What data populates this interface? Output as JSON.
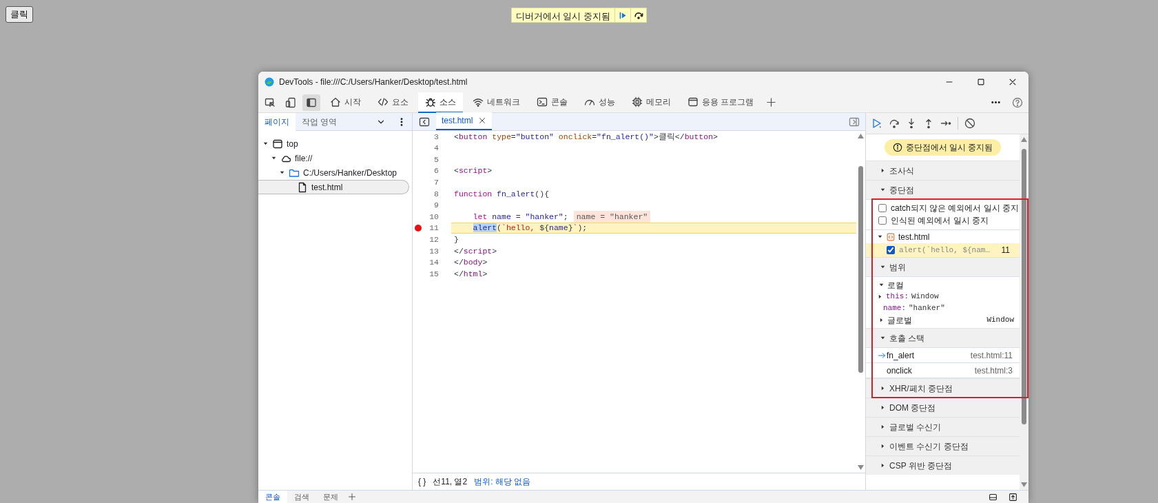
{
  "page_button": "클릭",
  "paused_banner": {
    "text": "디버거에서 일시 중지됨"
  },
  "window": {
    "title": "DevTools - file:///C:/Users/Hanker/Desktop/test.html"
  },
  "toolbar_tabs": [
    {
      "label": "시작",
      "kind": "home",
      "selected": false
    },
    {
      "label": "요소",
      "kind": "code",
      "selected": false
    },
    {
      "label": "소스",
      "kind": "bug",
      "selected": true
    },
    {
      "label": "네트워크",
      "kind": "wifi",
      "selected": false
    },
    {
      "label": "콘솔",
      "kind": "terminal",
      "selected": false
    },
    {
      "label": "성능",
      "kind": "gauge",
      "selected": false
    },
    {
      "label": "메모리",
      "kind": "chip",
      "selected": false
    },
    {
      "label": "응용 프로그램",
      "kind": "window",
      "selected": false
    }
  ],
  "navigator": {
    "tabs": [
      {
        "label": "페이지",
        "selected": true
      },
      {
        "label": "작업 영역",
        "selected": false
      }
    ],
    "tree": [
      {
        "label": "top",
        "kind": "frame",
        "expanded": true,
        "selected": false,
        "children": [
          {
            "label": "file://",
            "kind": "cloud",
            "expanded": true,
            "selected": false,
            "children": [
              {
                "label": "C:/Users/Hanker/Desktop",
                "kind": "folder",
                "expanded": true,
                "selected": false,
                "children": [
                  {
                    "label": "test.html",
                    "kind": "file",
                    "selected": true
                  }
                ]
              }
            ]
          }
        ]
      }
    ]
  },
  "editor": {
    "tabs": [
      {
        "label": "test.html",
        "selected": true
      }
    ],
    "lines": [
      {
        "number": "3",
        "breakpoint": false,
        "paused": false,
        "tokens": [
          {
            "kind": "punct",
            "text": "<"
          },
          {
            "kind": "tag",
            "text": "button"
          },
          {
            "kind": "attr",
            "text": " type"
          },
          {
            "kind": "punct",
            "text": "="
          },
          {
            "kind": "value",
            "text": "\"button\""
          },
          {
            "kind": "attr",
            "text": " onclick"
          },
          {
            "kind": "punct",
            "text": "="
          },
          {
            "kind": "value",
            "text": "\"fn_alert()\""
          },
          {
            "kind": "punct",
            "text": ">"
          },
          {
            "kind": "plain",
            "text": "클릭"
          },
          {
            "kind": "punct",
            "text": "</"
          },
          {
            "kind": "tag",
            "text": "button"
          },
          {
            "kind": "punct",
            "text": ">"
          }
        ]
      },
      {
        "number": "4",
        "breakpoint": false,
        "paused": false
      },
      {
        "number": "5",
        "breakpoint": false,
        "paused": false
      },
      {
        "number": "6",
        "breakpoint": false,
        "paused": false,
        "tokens": [
          {
            "kind": "punct",
            "text": "<"
          },
          {
            "kind": "tag",
            "text": "script"
          },
          {
            "kind": "punct",
            "text": ">"
          }
        ]
      },
      {
        "number": "7",
        "breakpoint": false,
        "paused": false
      },
      {
        "number": "8",
        "breakpoint": false,
        "paused": false,
        "tokens": [
          {
            "kind": "keyword",
            "text": "function"
          },
          {
            "kind": "ident",
            "text": " fn_alert"
          },
          {
            "kind": "punct",
            "text": "(){"
          }
        ]
      },
      {
        "number": "9",
        "breakpoint": false,
        "paused": false
      },
      {
        "number": "10",
        "breakpoint": false,
        "paused": false,
        "indented": true,
        "inline_value": "name = \"hanker\"",
        "tokens": [
          {
            "kind": "keyword",
            "text": "let"
          },
          {
            "kind": "ident",
            "text": " name"
          },
          {
            "kind": "punct",
            "text": " = "
          },
          {
            "kind": "string",
            "text": "\"hanker\""
          },
          {
            "kind": "punct",
            "text": ";"
          }
        ]
      },
      {
        "number": "11",
        "breakpoint": true,
        "paused": true,
        "indented": true,
        "tokens": [
          {
            "kind": "ident",
            "text": "alert",
            "selected": true
          },
          {
            "kind": "punct",
            "text": "("
          },
          {
            "kind": "template",
            "text": "`hello, "
          },
          {
            "kind": "punct",
            "text": "${"
          },
          {
            "kind": "ident",
            "text": "name"
          },
          {
            "kind": "punct",
            "text": "}"
          },
          {
            "kind": "template",
            "text": "`"
          },
          {
            "kind": "punct",
            "text": ");"
          }
        ]
      },
      {
        "number": "12",
        "breakpoint": false,
        "paused": false,
        "tokens": [
          {
            "kind": "punct",
            "text": "}"
          }
        ]
      },
      {
        "number": "13",
        "breakpoint": false,
        "paused": false,
        "tokens": [
          {
            "kind": "punct",
            "text": "</"
          },
          {
            "kind": "tag",
            "text": "script"
          },
          {
            "kind": "punct",
            "text": ">"
          }
        ]
      },
      {
        "number": "14",
        "breakpoint": false,
        "paused": false,
        "tokens": [
          {
            "kind": "punct",
            "text": "</"
          },
          {
            "kind": "tag",
            "text": "body"
          },
          {
            "kind": "punct",
            "text": ">"
          }
        ]
      },
      {
        "number": "15",
        "breakpoint": false,
        "paused": false,
        "tokens": [
          {
            "kind": "punct",
            "text": "</"
          },
          {
            "kind": "tag",
            "text": "html"
          },
          {
            "kind": "punct",
            "text": ">"
          }
        ]
      }
    ]
  },
  "status_bar": {
    "format": "{ }",
    "position": "선11, 열2",
    "scope": "범위: 해당 없음"
  },
  "debugger": {
    "paused_message": "중단점에서 일시 중지됨",
    "sections": [
      {
        "title": "조사식",
        "kind": "plain",
        "expanded": false
      },
      {
        "title": "중단점",
        "kind": "breakpoints",
        "expanded": true,
        "options": [
          {
            "label": "catch되지 않은 예외에서 일시 중지",
            "checked": false
          },
          {
            "label": "인식된 예외에서 일시 중지",
            "checked": false
          }
        ],
        "files": [
          {
            "name": "test.html",
            "expanded": true,
            "breakpoints": [
              {
                "code": "alert(`hello, ${nam…",
                "line": "11",
                "checked": true,
                "selected": true
              }
            ]
          }
        ]
      },
      {
        "title": "범위",
        "kind": "scope",
        "expanded": true,
        "scopes": [
          {
            "label": "로컬",
            "expanded": true,
            "children": [
              {
                "key": "this:",
                "value": "Window",
                "expanded": false
              },
              {
                "key": "name:",
                "value": "\"hanker\""
              }
            ]
          },
          {
            "label": "글로벌",
            "expanded": false,
            "value": "Window"
          }
        ]
      },
      {
        "title": "호출 스택",
        "kind": "callstack",
        "expanded": true,
        "frames": [
          {
            "function": "fn_alert",
            "location": "test.html:11",
            "selected": true
          },
          {
            "function": "onclick",
            "location": "test.html:3",
            "selected": false
          }
        ]
      },
      {
        "title": "XHR/페치 중단점",
        "kind": "plain",
        "expanded": false
      },
      {
        "title": "DOM 중단점",
        "kind": "plain",
        "expanded": false
      },
      {
        "title": "글로벌 수신기",
        "kind": "plain",
        "expanded": false
      },
      {
        "title": "이벤트 수신기 중단점",
        "kind": "plain",
        "expanded": false
      },
      {
        "title": "CSP 위반 중단점",
        "kind": "plain",
        "expanded": false
      }
    ]
  },
  "drawer_tabs": [
    {
      "label": "콘솔",
      "selected": true
    },
    {
      "label": "검색",
      "selected": false
    },
    {
      "label": "문제",
      "selected": false
    }
  ]
}
